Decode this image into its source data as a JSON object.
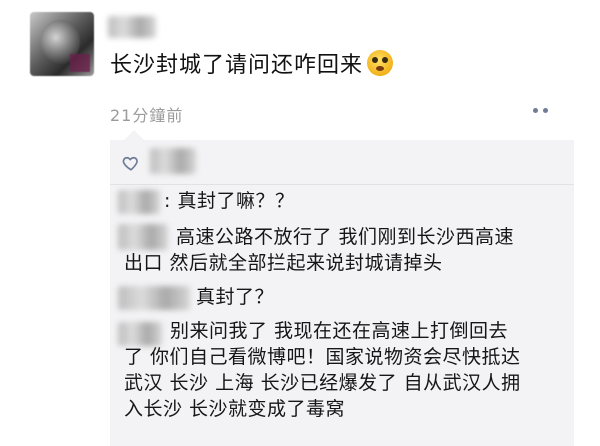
{
  "post": {
    "text": "长沙封城了请问还咋回来",
    "emoji_icon": "dizzy-face-emoji-icon",
    "time": "21分鐘前"
  },
  "likes": {
    "icon": "heart-outline-icon"
  },
  "comments": [
    {
      "text": "真封了嘛？？"
    },
    {
      "lines": [
        "高速公路不放行了 我们刚到长沙西高速",
        "出口 然后就全部拦起来说封城请掉头"
      ]
    },
    {
      "text": "真封了？"
    },
    {
      "lines": [
        "别来问我了 我现在还在高速上打倒回去",
        "了 你们自己看微博吧！国家说物资会尽快抵达",
        "武汉 长沙 上海 长沙已经爆发了 自从武汉人拥",
        "入长沙 长沙就变成了毒窝"
      ]
    }
  ],
  "colors": {
    "time_text": "#9b9b9b",
    "comment_bg": "#f3f3f5",
    "more_dots": "#6f7c97",
    "heart": "#6f7c97"
  }
}
